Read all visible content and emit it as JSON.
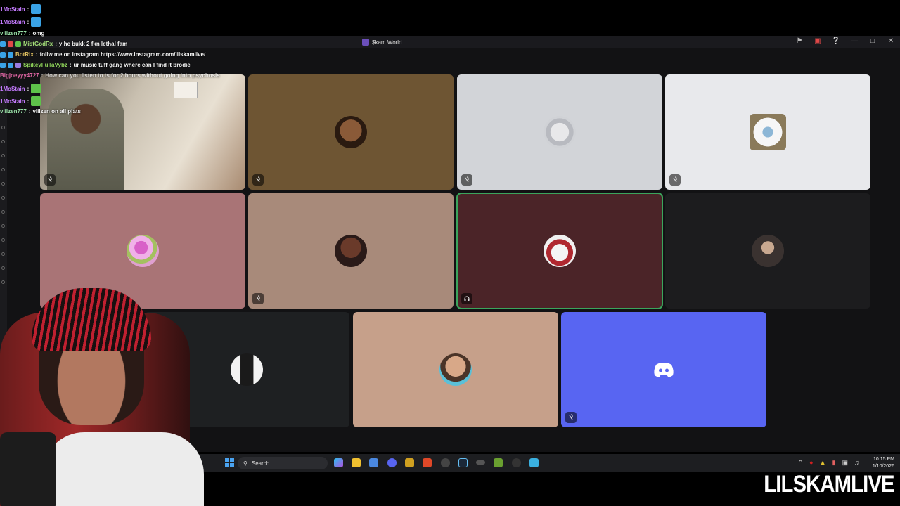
{
  "window": {
    "title": "$kam World"
  },
  "chat": {
    "lines": [
      {
        "user": "1MoStain",
        "sep": " :",
        "msg": "",
        "color": "#c57bff",
        "emote": "#3aa3e6"
      },
      {
        "user": "1MoStain",
        "sep": " :",
        "msg": "",
        "color": "#c57bff",
        "emote": "#3aa3e6"
      },
      {
        "user": "vlilzen777",
        "sep": " :",
        "msg": "omg",
        "color": "#9ae2a8",
        "emote": ""
      },
      {
        "user": "MistGodRx",
        "sep": " :",
        "msg": "y he bukk 2 fkn lethal fam",
        "color": "#a6e27a",
        "emote": ""
      },
      {
        "user": "BotRix",
        "sep": " :",
        "msg": "follw me on instagram https://www.instagram.com/lilskamlive/",
        "color": "#e0c060",
        "emote": ""
      },
      {
        "user": "SpikeyFullaVybz",
        "sep": " :",
        "msg": "ur music tuff gang where can I find it brodie",
        "color": "#8fd45a",
        "emote": ""
      },
      {
        "user": "Bigjoeyyy4727",
        "sep": " :",
        "msg": "How can you listen to ts for 2 hours without going into psychosis",
        "color": "#e066a3",
        "emote": ""
      },
      {
        "user": "1MoStain",
        "sep": " :",
        "msg": "",
        "color": "#c57bff",
        "emote": "#5ec24a"
      },
      {
        "user": "1MoStain",
        "sep": " :",
        "msg": "",
        "color": "#c57bff",
        "emote": "#5ec24a"
      },
      {
        "user": "vlilzen777",
        "sep": " :",
        "msg": "vlilzen on all plats",
        "color": "#9ae2a8",
        "emote": ""
      }
    ]
  },
  "taskbar": {
    "search_label": "Search",
    "time": "10:15 PM",
    "date": "1/10/2026"
  },
  "brand": {
    "name": "LILSKAMLIVE"
  },
  "colors": {
    "speaking": "#3ba55c",
    "discord_blurple": "#5865f2"
  }
}
